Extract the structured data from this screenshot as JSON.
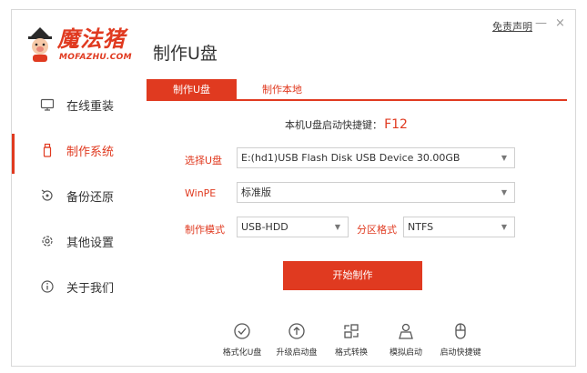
{
  "window": {
    "title": "制作U盘",
    "disclaimer": "免责声明",
    "minimize": "—",
    "close": "×"
  },
  "logo": {
    "name": "魔法猪",
    "sub": "MOFAZHU.COM"
  },
  "sidebar": {
    "items": [
      {
        "label": "在线重装",
        "icon": "monitor-icon"
      },
      {
        "label": "制作系统",
        "icon": "usb-icon",
        "active": true
      },
      {
        "label": "备份还原",
        "icon": "restore-icon"
      },
      {
        "label": "其他设置",
        "icon": "gear-icon"
      },
      {
        "label": "关于我们",
        "icon": "info-icon"
      }
    ]
  },
  "tabs": [
    {
      "label": "制作U盘",
      "active": true
    },
    {
      "label": "制作本地",
      "active": false
    }
  ],
  "hotkey": {
    "label": "本机U盘启动快捷键：",
    "key": "F12"
  },
  "form": {
    "usb_label": "选择U盘",
    "usb_value": "E:(hd1)USB Flash Disk USB Device 30.00GB",
    "winpe_label": "WinPE",
    "winpe_value": "标准版",
    "mode_label": "制作模式",
    "mode_value": "USB-HDD",
    "partition_label": "分区格式",
    "partition_value": "NTFS"
  },
  "start_button": "开始制作",
  "tools": [
    {
      "label": "格式化U盘",
      "icon": "check-circle-icon"
    },
    {
      "label": "升级启动盘",
      "icon": "upgrade-icon"
    },
    {
      "label": "格式转换",
      "icon": "convert-icon"
    },
    {
      "label": "模拟启动",
      "icon": "simulate-icon"
    },
    {
      "label": "启动快捷键",
      "icon": "mouse-icon"
    }
  ],
  "colors": {
    "accent": "#e03a20",
    "border": "#d8d8d8"
  }
}
